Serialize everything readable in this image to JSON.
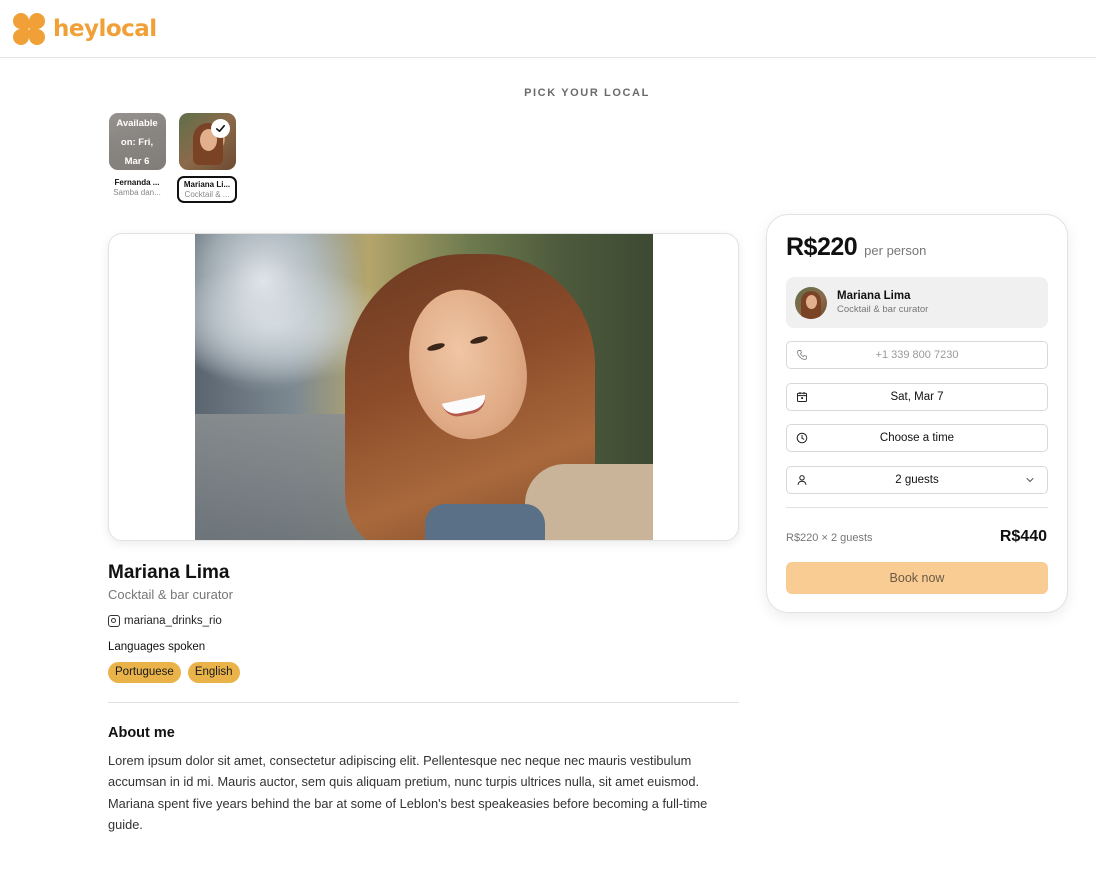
{
  "brand": {
    "name": "heylocal",
    "color": "#f0a036"
  },
  "picker": {
    "title": "PICK YOUR LOCAL",
    "locals": [
      {
        "name": "Fernanda ...",
        "subtitle": "Samba dan...",
        "availability": "Available on: Fri, Mar 6",
        "selected": false
      },
      {
        "name": "Mariana Li...",
        "subtitle": "Cocktail & ...",
        "selected": true,
        "icon": "check-icon"
      }
    ]
  },
  "profile": {
    "name": "Mariana Lima",
    "role": "Cocktail & bar curator",
    "instagram_icon": "instagram-icon",
    "instagram": "mariana_drinks_rio",
    "languages_label": "Languages spoken",
    "languages": [
      "Portuguese",
      "English"
    ],
    "about_title": "About me",
    "about_text": "Lorem ipsum dolor sit amet, consectetur adipiscing elit. Pellentesque nec neque nec mauris vestibulum accumsan in id mi. Mauris auctor, sem quis aliquam pretium, nunc turpis ultrices nulla, sit amet euismod. Mariana spent five years behind the bar at some of Leblon's best speakeasies before becoming a full-time guide."
  },
  "booking": {
    "price": "R$220",
    "per": "per person",
    "host_name": "Mariana Lima",
    "host_role": "Cocktail & bar curator",
    "phone_placeholder": "+1 339 800 7230",
    "phone_icon": "phone-icon",
    "date": "Sat, Mar 7",
    "date_icon": "calendar-icon",
    "time": "Choose a time",
    "time_icon": "clock-icon",
    "guests": "2 guests",
    "guests_icon": "person-icon",
    "calc": "R$220 × 2 guests",
    "total": "R$440",
    "book_label": "Book now",
    "button_color": "#f9cc94",
    "tag_color": "#e9b34a"
  }
}
